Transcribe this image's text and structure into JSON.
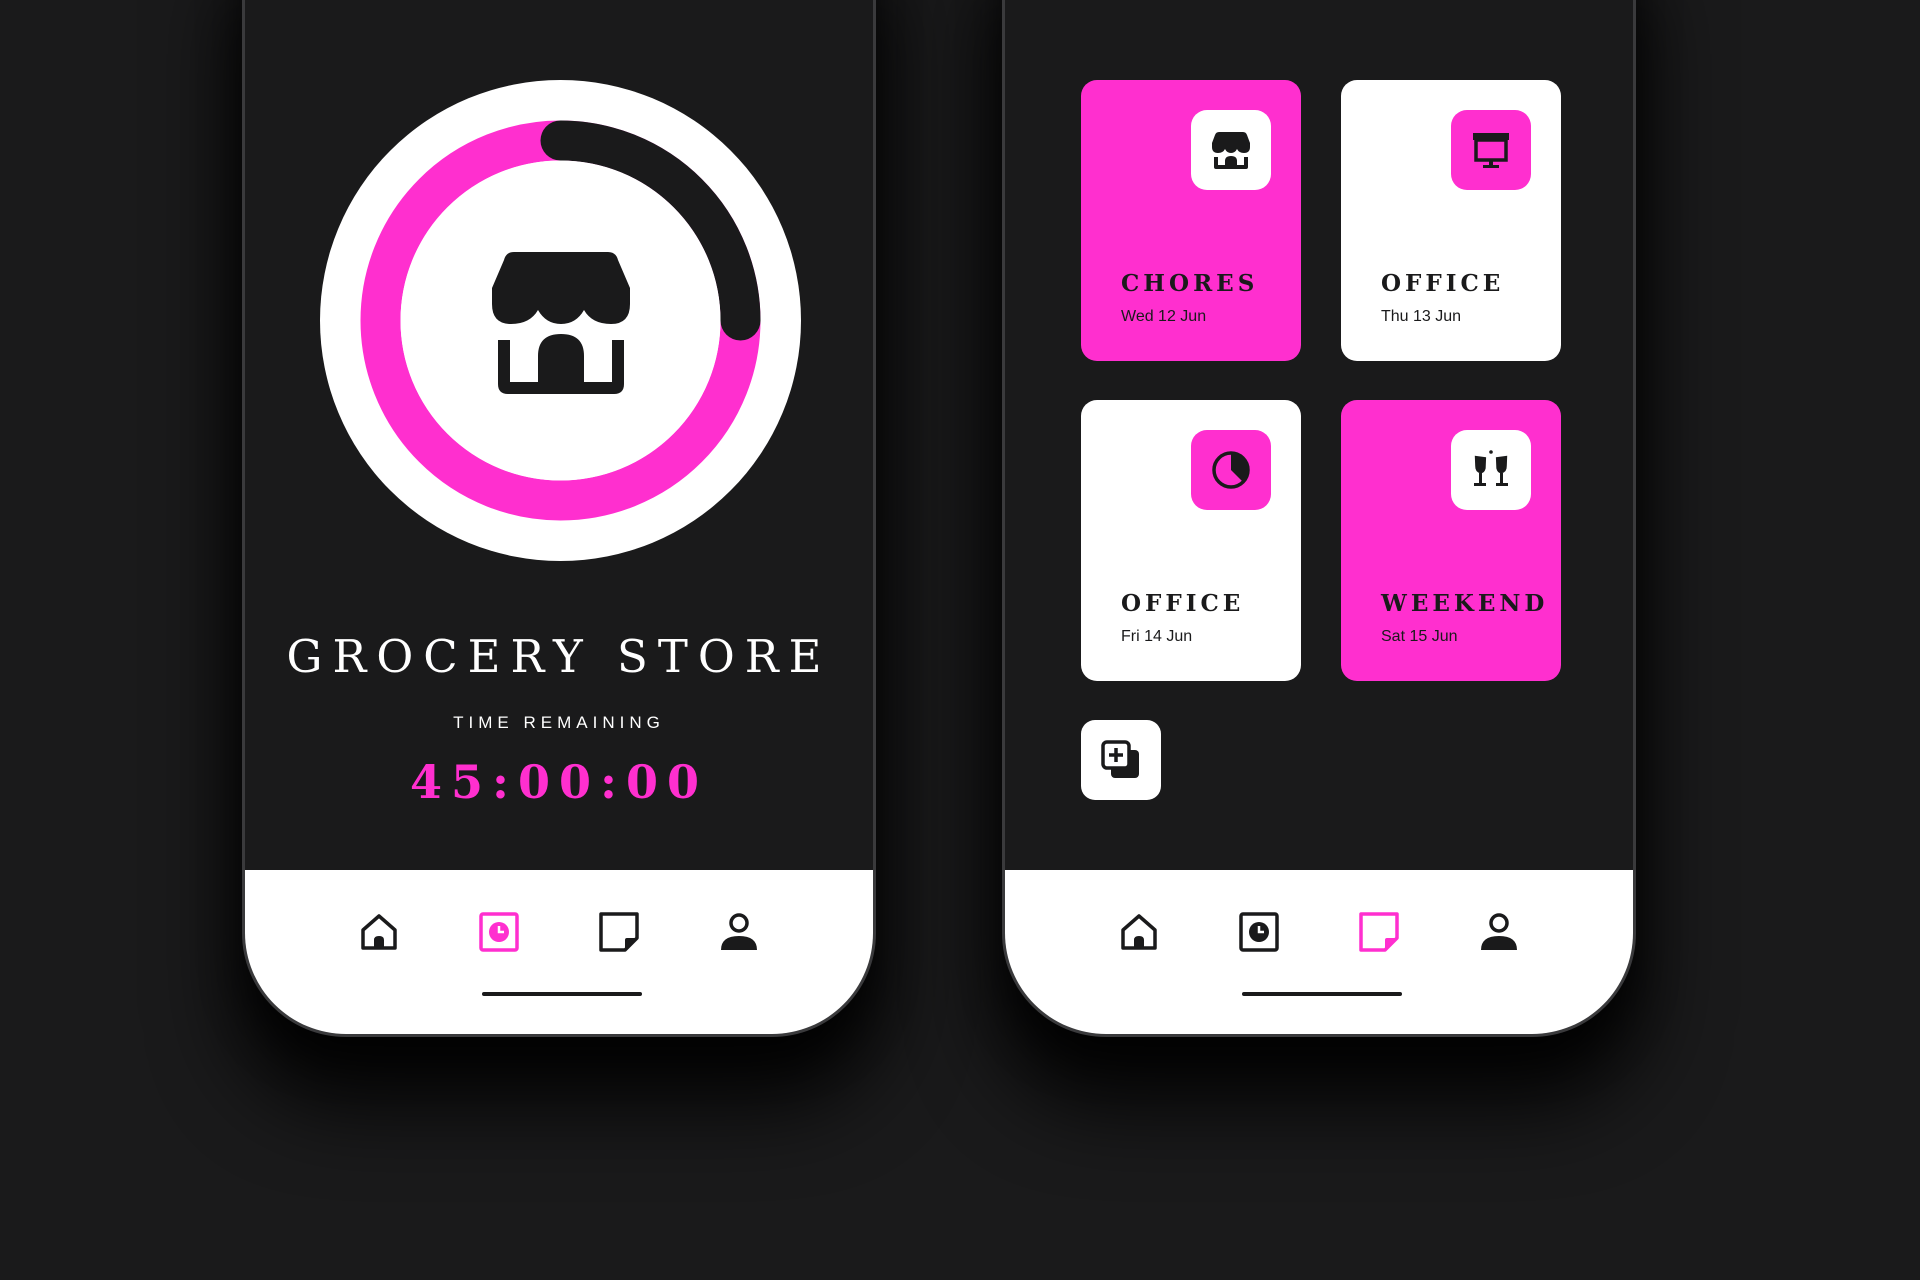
{
  "colors": {
    "background": "#1a1a1b",
    "accent": "#ff2fcf",
    "surface": "#ffffff",
    "dark": "#1a1a1b"
  },
  "timer_screen": {
    "title": "GROCERY STORE",
    "subtitle": "TIME REMAINING",
    "time_remaining": "45:00:00",
    "progress_fraction": 0.75,
    "center_icon": "store-icon"
  },
  "schedule_screen": {
    "cards": [
      {
        "title": "CHORES",
        "date": "Wed 12 Jun",
        "icon": "store-icon",
        "style": "pink"
      },
      {
        "title": "OFFICE",
        "date": "Thu 13 Jun",
        "icon": "presentation-icon",
        "style": "white"
      },
      {
        "title": "OFFICE",
        "date": "Fri 14 Jun",
        "icon": "pie-chart-icon",
        "style": "white"
      },
      {
        "title": "WEEKEND",
        "date": "Sat 15 Jun",
        "icon": "cheers-icon",
        "style": "pink"
      }
    ],
    "add_button_icon": "add-copy-icon"
  },
  "nav_left": {
    "items": [
      "home-icon",
      "timer-icon",
      "note-icon",
      "profile-icon"
    ],
    "active": "timer-icon"
  },
  "nav_right": {
    "items": [
      "home-icon",
      "timer-icon",
      "note-icon",
      "profile-icon"
    ],
    "active": "note-icon"
  }
}
